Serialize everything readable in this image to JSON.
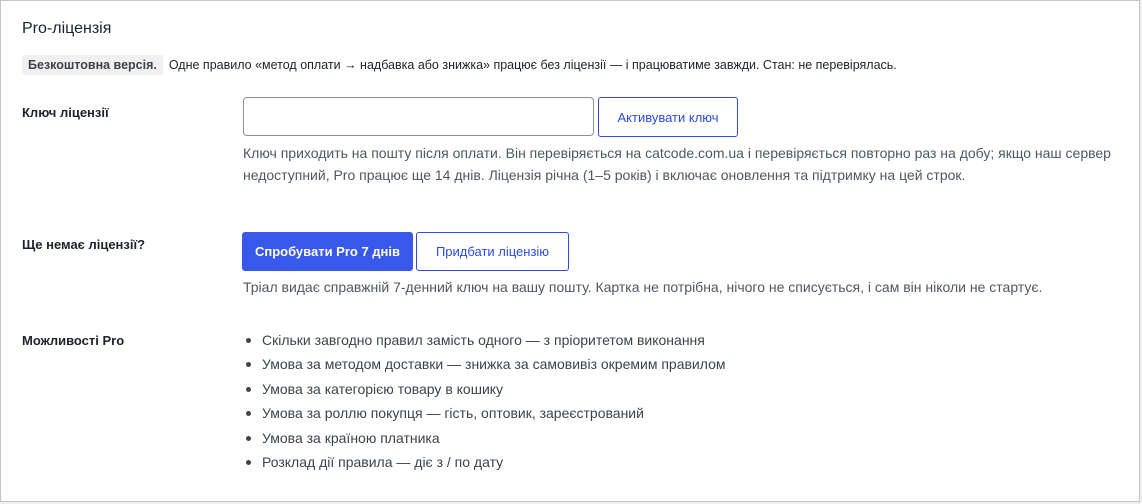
{
  "title": "Pro-ліцензія",
  "status": {
    "badge": "Безкоштовна версія.",
    "text": "Одне правило «метод оплати → надбавка або знижка» працює без ліцензії — і працюватиме завжди. Стан: не перевірялась."
  },
  "license_key": {
    "label": "Ключ ліцензії",
    "value": "",
    "placeholder": "",
    "activate_label": "Активувати ключ",
    "help_line1": "Ключ приходить на пошту після оплати. Він перевіряється на catcode.com.ua і перевіряється повторно раз на добу; якщо наш сервер",
    "help_line2": "недоступний, Pro працює ще 14 днів. Ліцензія річна (1–5 років) і включає оновлення та підтримку на цей строк."
  },
  "no_license": {
    "label": "Ще немає ліцензії?",
    "trial_label": "Спробувати Pro 7 днів",
    "buy_label": "Придбати ліцензію",
    "help": "Тріал видає справжній 7-денний ключ на вашу пошту. Картка не потрібна, нічого не списується, і сам він ніколи не стартує."
  },
  "features": {
    "label": "Можливості Pro",
    "items": [
      "Скільки завгодно правил замість одного — з пріоритетом виконання",
      "Умова за методом доставки — знижка за самовивіз окремим правилом",
      "Умова за категорією товару в кошику",
      "Умова за роллю покупця — гість, оптовик, зареєстрований",
      "Умова за країною платника",
      "Розклад дії правила — діє з / по дату"
    ]
  }
}
